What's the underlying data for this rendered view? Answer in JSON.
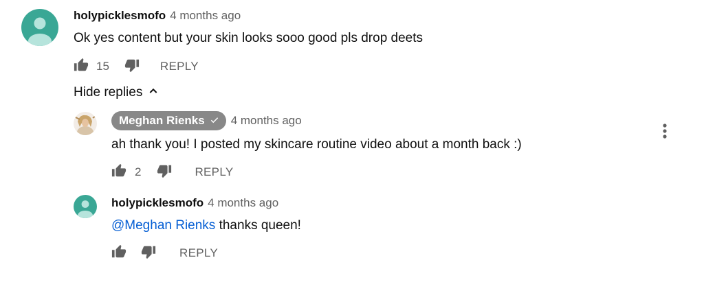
{
  "comment": {
    "author": "holypicklesmofo",
    "time": "4 months ago",
    "text": "Ok yes content but your skin looks sooo good pls drop deets",
    "likes": "15",
    "reply_label": "REPLY"
  },
  "hide_replies_label": "Hide replies",
  "replies": [
    {
      "author": "Meghan Rienks",
      "verified_icon": "checkmark-icon",
      "time": "4 months ago",
      "text": "ah thank you! I posted my skincare routine video about a month back :)",
      "likes": "2",
      "reply_label": "REPLY"
    },
    {
      "author": "holypicklesmofo",
      "time": "4 months ago",
      "mention": "@Meghan Rienks",
      "text": " thanks queen!",
      "reply_label": "REPLY"
    }
  ],
  "colors": {
    "avatar": "#3aa795",
    "avatar_figure": "#b6e4dc",
    "link": "#065fd4",
    "badge": "#888888",
    "muted": "#606060"
  }
}
